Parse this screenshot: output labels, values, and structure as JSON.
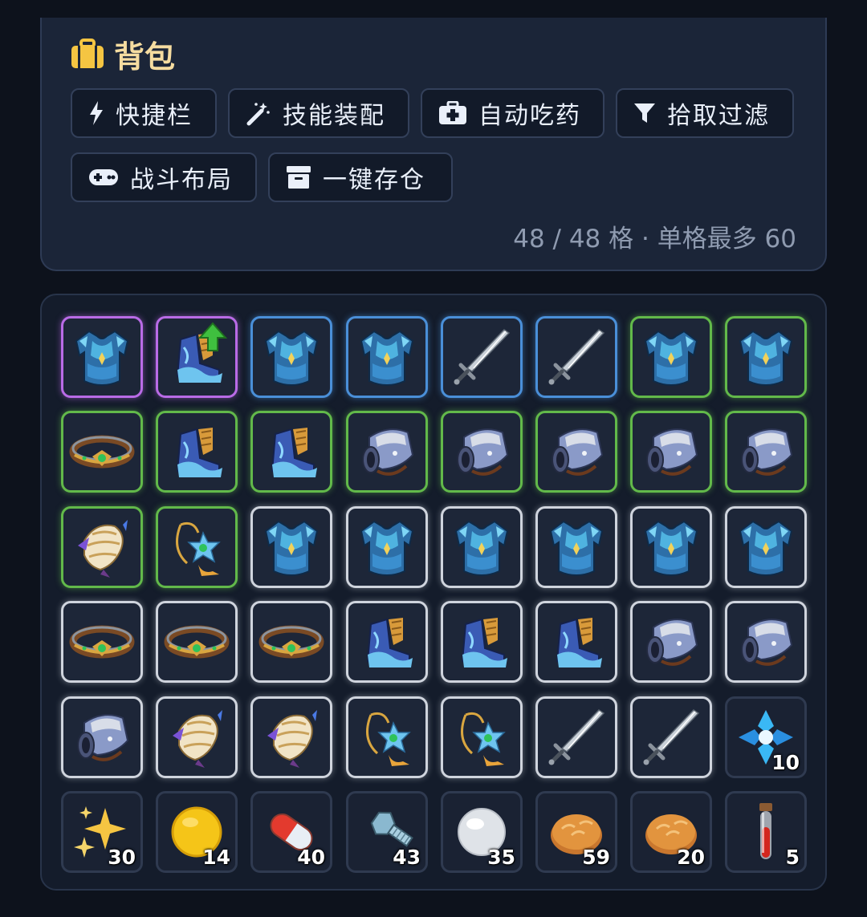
{
  "header": {
    "title": "背包",
    "title_icon": "briefcase-icon",
    "accent": "#f5c542"
  },
  "buttons": [
    {
      "label": "快捷栏",
      "icon": "bolt-icon"
    },
    {
      "label": "技能装配",
      "icon": "magic-wand-icon"
    },
    {
      "label": "自动吃药",
      "icon": "medkit-icon"
    },
    {
      "label": "拾取过滤",
      "icon": "filter-icon"
    },
    {
      "label": "战斗布局",
      "icon": "gamepad-icon"
    },
    {
      "label": "一键存仓",
      "icon": "archive-icon"
    }
  ],
  "capacity": {
    "text": "48 / 48 格 · 单格最多 60"
  },
  "rarity_colors": {
    "purple": "#b96be6",
    "blue": "#4a8fd8",
    "green": "#62b94a",
    "white": "#cfd4dd"
  },
  "inventory": [
    {
      "item": "armor-icon",
      "rarity": "purple"
    },
    {
      "item": "boots-icon",
      "rarity": "purple",
      "upgrade": true
    },
    {
      "item": "armor-icon",
      "rarity": "blue"
    },
    {
      "item": "armor-icon",
      "rarity": "blue"
    },
    {
      "item": "sword-icon",
      "rarity": "blue"
    },
    {
      "item": "sword-icon",
      "rarity": "blue"
    },
    {
      "item": "armor-icon",
      "rarity": "green"
    },
    {
      "item": "armor-icon",
      "rarity": "green"
    },
    {
      "item": "belt-icon",
      "rarity": "green"
    },
    {
      "item": "boots-icon",
      "rarity": "green"
    },
    {
      "item": "boots-icon",
      "rarity": "green"
    },
    {
      "item": "gauntlet-icon",
      "rarity": "green"
    },
    {
      "item": "gauntlet-icon",
      "rarity": "green"
    },
    {
      "item": "gauntlet-icon",
      "rarity": "green"
    },
    {
      "item": "gauntlet-icon",
      "rarity": "green"
    },
    {
      "item": "gauntlet-icon",
      "rarity": "green"
    },
    {
      "item": "shoulder-icon",
      "rarity": "green"
    },
    {
      "item": "amulet-icon",
      "rarity": "green"
    },
    {
      "item": "armor-icon",
      "rarity": "white"
    },
    {
      "item": "armor-icon",
      "rarity": "white"
    },
    {
      "item": "armor-icon",
      "rarity": "white"
    },
    {
      "item": "armor-icon",
      "rarity": "white"
    },
    {
      "item": "armor-icon",
      "rarity": "white"
    },
    {
      "item": "armor-icon",
      "rarity": "white"
    },
    {
      "item": "belt-icon",
      "rarity": "white"
    },
    {
      "item": "belt-icon",
      "rarity": "white"
    },
    {
      "item": "belt-icon",
      "rarity": "white"
    },
    {
      "item": "boots-icon",
      "rarity": "white"
    },
    {
      "item": "boots-icon",
      "rarity": "white"
    },
    {
      "item": "boots-icon",
      "rarity": "white"
    },
    {
      "item": "gauntlet-icon",
      "rarity": "white"
    },
    {
      "item": "gauntlet-icon",
      "rarity": "white"
    },
    {
      "item": "gauntlet-icon",
      "rarity": "white"
    },
    {
      "item": "shoulder-icon",
      "rarity": "white"
    },
    {
      "item": "shoulder-icon",
      "rarity": "white"
    },
    {
      "item": "amulet-icon",
      "rarity": "white"
    },
    {
      "item": "amulet-icon",
      "rarity": "white"
    },
    {
      "item": "sword-icon",
      "rarity": "white"
    },
    {
      "item": "sword-icon",
      "rarity": "white"
    },
    {
      "item": "crystal-icon",
      "rarity": "none",
      "count": "10"
    },
    {
      "item": "sparkles-icon",
      "rarity": "none",
      "count": "30"
    },
    {
      "item": "gold-coin-icon",
      "rarity": "none",
      "count": "14"
    },
    {
      "item": "pill-icon",
      "rarity": "none",
      "count": "40"
    },
    {
      "item": "bolt-nut-icon",
      "rarity": "none",
      "count": "43"
    },
    {
      "item": "pearl-icon",
      "rarity": "none",
      "count": "35"
    },
    {
      "item": "bread-icon",
      "rarity": "none",
      "count": "59"
    },
    {
      "item": "bread-icon",
      "rarity": "none",
      "count": "20"
    },
    {
      "item": "potion-icon",
      "rarity": "none",
      "count": "5"
    }
  ]
}
